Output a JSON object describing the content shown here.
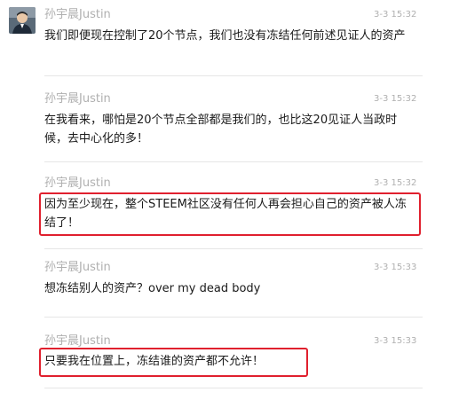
{
  "messages": [
    {
      "sender": "孙宇晨Justin",
      "time": "3-3 15:32",
      "text": "我们即便现在控制了20个节点，我们也没有冻结任何前述见证人的资产",
      "avatar": "avatar-photo",
      "highlighted": false
    },
    {
      "sender": "孙宇晨Justin",
      "time": "3-3 15:32",
      "text": "在我看来，哪怕是20个节点全部都是我们的，也比这20见证人当政时候，去中心化的多！",
      "highlighted": false
    },
    {
      "sender": "孙宇晨Justin",
      "time": "3-3 15:32",
      "text": "因为至少现在，整个STEEM社区没有任何人再会担心自己的资产被人冻结了！",
      "highlighted": true
    },
    {
      "sender": "孙宇晨Justin",
      "time": "3-3 15:33",
      "text": "想冻结别人的资产？over my dead body",
      "highlighted": false
    },
    {
      "sender": "孙宇晨Justin",
      "time": "3-3 15:33",
      "text": "只要我在位置上，冻结谁的资产都不允许！",
      "highlighted": true
    }
  ],
  "colors": {
    "highlight_border": "#e0202e",
    "meta_text": "#b0b0b0",
    "body_text": "#1a1a1a",
    "divider": "#e6e6e6"
  }
}
